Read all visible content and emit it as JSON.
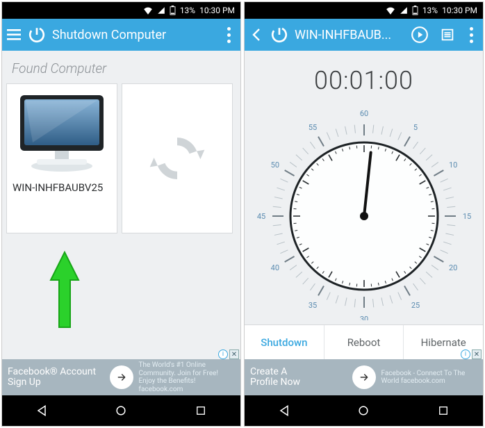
{
  "status": {
    "battery_pct": "13%",
    "time": "10:30 PM"
  },
  "left": {
    "title": "Shutdown Computer",
    "section": "Found Computer",
    "computer_name": "WIN-INHFBAUBV25",
    "ad": {
      "left": "Facebook® Account\nSign Up",
      "right": "The World's #1 Online Community. Join for Free! Enjoy the Benefits! facebook.com"
    }
  },
  "right": {
    "title": "WIN-INHFBAUB...",
    "timer": "00:01:00",
    "dial": {
      "min": 0,
      "max": 60,
      "value": 1
    },
    "actions": {
      "shutdown": "Shutdown",
      "reboot": "Reboot",
      "hibernate": "Hibernate",
      "selected": "shutdown"
    },
    "ad": {
      "left": "Create A\nProfile Now",
      "right": "Facebook - Connect To The World facebook.com"
    }
  }
}
